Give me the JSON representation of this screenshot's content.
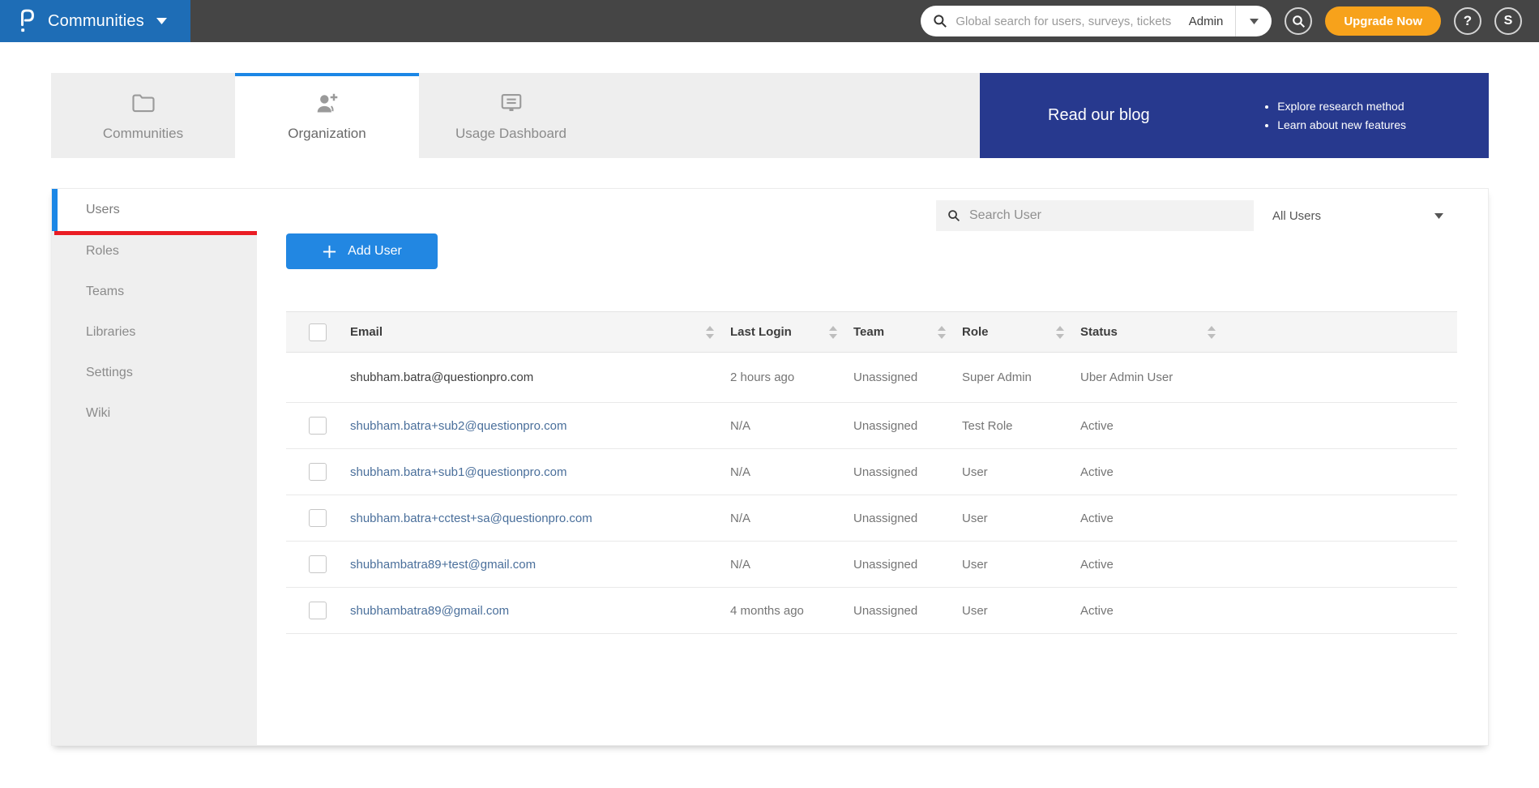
{
  "topbar": {
    "product": "Communities",
    "global_search": {
      "placeholder": "Global search for users, surveys, tickets",
      "scope": "Admin"
    },
    "upgrade_label": "Upgrade Now",
    "help_label": "?",
    "avatar_initial": "S"
  },
  "tabs": [
    {
      "label": "Communities",
      "icon": "folder-icon",
      "active": false
    },
    {
      "label": "Organization",
      "icon": "person-plus-icon",
      "active": true
    },
    {
      "label": "Usage Dashboard",
      "icon": "dashboard-icon",
      "active": false
    }
  ],
  "blog_banner": {
    "title": "Read our blog",
    "bullets": [
      "Explore research method",
      "Learn about new features"
    ]
  },
  "sidebar": {
    "items": [
      {
        "label": "Users",
        "active": true
      },
      {
        "label": "Roles",
        "active": false
      },
      {
        "label": "Teams",
        "active": false
      },
      {
        "label": "Libraries",
        "active": false
      },
      {
        "label": "Settings",
        "active": false
      },
      {
        "label": "Wiki",
        "active": false
      }
    ]
  },
  "content": {
    "add_user_label": "Add User",
    "user_search_placeholder": "Search User",
    "filter_value": "All Users",
    "table": {
      "columns": [
        {
          "label": "Email"
        },
        {
          "label": "Last Login"
        },
        {
          "label": "Team"
        },
        {
          "label": "Role"
        },
        {
          "label": "Status"
        }
      ],
      "rows": [
        {
          "checkbox": false,
          "email": "shubham.batra@questionpro.com",
          "email_is_link": false,
          "last_login": "2 hours ago",
          "team": "Unassigned",
          "role": "Super Admin",
          "status": "Uber Admin User"
        },
        {
          "checkbox": true,
          "email": "shubham.batra+sub2@questionpro.com",
          "email_is_link": true,
          "last_login": "N/A",
          "team": "Unassigned",
          "role": "Test Role",
          "status": "Active"
        },
        {
          "checkbox": true,
          "email": "shubham.batra+sub1@questionpro.com",
          "email_is_link": true,
          "last_login": "N/A",
          "team": "Unassigned",
          "role": "User",
          "status": "Active"
        },
        {
          "checkbox": true,
          "email": "shubham.batra+cctest+sa@questionpro.com",
          "email_is_link": true,
          "last_login": "N/A",
          "team": "Unassigned",
          "role": "User",
          "status": "Active"
        },
        {
          "checkbox": true,
          "email": "shubhambatra89+test@gmail.com",
          "email_is_link": true,
          "last_login": "N/A",
          "team": "Unassigned",
          "role": "User",
          "status": "Active"
        },
        {
          "checkbox": true,
          "email": "shubhambatra89@gmail.com",
          "email_is_link": true,
          "last_login": "4 months ago",
          "team": "Unassigned",
          "role": "User",
          "status": "Active"
        }
      ]
    }
  },
  "colors": {
    "accent_blue": "#1b87e6",
    "brand_blue": "#1e6db6",
    "topbar_gray": "#454545",
    "navy": "#27398e",
    "orange": "#f7a21b",
    "red": "#ea1d24",
    "link_blue": "#4a6f9b"
  }
}
